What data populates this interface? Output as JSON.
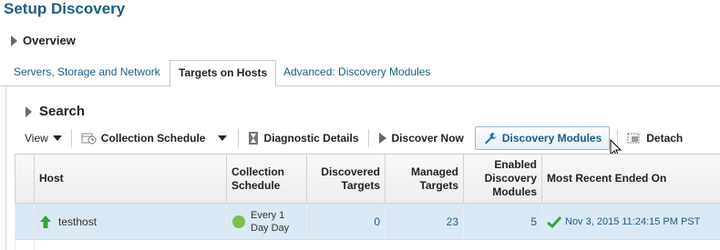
{
  "page": {
    "title": "Setup Discovery"
  },
  "overview": {
    "label": "Overview"
  },
  "tabs": [
    {
      "label": "Servers, Storage and Network"
    },
    {
      "label": "Targets on Hosts"
    },
    {
      "label": "Advanced: Discovery Modules"
    }
  ],
  "search": {
    "label": "Search"
  },
  "toolbar": {
    "view": "View",
    "collection_schedule": "Collection Schedule",
    "diagnostic_details": "Diagnostic Details",
    "discover_now": "Discover Now",
    "discovery_modules": "Discovery Modules",
    "detach": "Detach"
  },
  "table": {
    "headers": {
      "host": "Host",
      "collection_schedule": "Collection Schedule",
      "discovered_targets": "Discovered Targets",
      "managed_targets": "Managed Targets",
      "enabled_modules": "Enabled Discovery Modules",
      "most_recent": "Most Recent Ended On"
    },
    "rows": [
      {
        "host": "testhost",
        "schedule": "Every 1 Day Day",
        "discovered": "0",
        "managed": "23",
        "enabled": "5",
        "most_recent": "Nov 3, 2015 11:24:15 PM PST"
      }
    ]
  },
  "colors": {
    "title": "#1f5c85",
    "link": "#1f5c85",
    "selected_row": "#dbe9f4",
    "status_up": "#3aa13a",
    "schedule_dot": "#7cbf4d"
  },
  "icons": {
    "collection_schedule": "calendar-clock-icon",
    "diagnostic_details": "hourglass-icon",
    "discover_now": "play-icon",
    "discovery_modules": "wrench-icon",
    "detach": "detach-icon",
    "host_status": "up-arrow-icon",
    "schedule_status": "green-circle-icon",
    "result_status": "checkmark-icon"
  }
}
